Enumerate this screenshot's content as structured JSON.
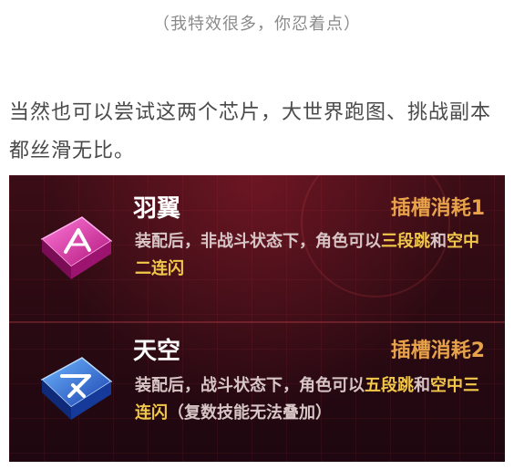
{
  "caption": "（我特效很多，你忍着点）",
  "paragraph": "当然也可以尝试这两个芯片，大世界跑图、挑战副本都丝滑无比。",
  "chips": [
    {
      "name": "羽翼",
      "cost": "插槽消耗1",
      "desc_parts": [
        "装配后，非战斗状态下，角色可以",
        "三段跳",
        "和",
        "空中二连闪"
      ],
      "icon": "pink-wing-chip-icon",
      "color": "#e23ab0"
    },
    {
      "name": "天空",
      "cost": "插槽消耗2",
      "desc_parts": [
        "装配后，战斗状态下，角色可以",
        "五段跳",
        "和",
        "空中三连闪",
        "（复数技能无法叠加）"
      ],
      "icon": "blue-sky-chip-icon",
      "color": "#2f6fe6"
    }
  ],
  "colors": {
    "highlight": "#f2c84a",
    "cost": "#e8a24a",
    "panel_bg": "#2a0a12"
  }
}
